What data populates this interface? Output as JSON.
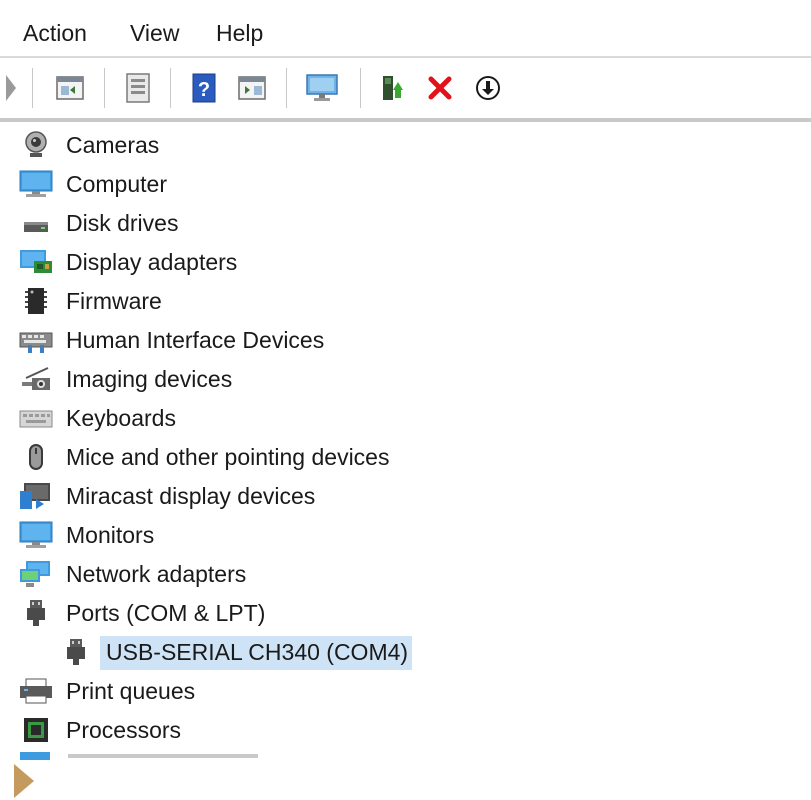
{
  "menu": {
    "action": "Action",
    "view": "View",
    "help": "Help"
  },
  "toolbar": {
    "buttons": [
      "expand-icon",
      "properties-icon",
      "document-icon",
      "help-icon",
      "show-hide-icon",
      "monitor-icon",
      "update-driver-icon",
      "uninstall-icon",
      "download-icon"
    ]
  },
  "tree": {
    "items": [
      {
        "label": "Cameras",
        "icon": "camera-icon"
      },
      {
        "label": "Computer",
        "icon": "computer-icon"
      },
      {
        "label": "Disk drives",
        "icon": "disk-drive-icon"
      },
      {
        "label": "Display adapters",
        "icon": "display-adapter-icon"
      },
      {
        "label": "Firmware",
        "icon": "firmware-icon"
      },
      {
        "label": "Human Interface Devices",
        "icon": "hid-icon"
      },
      {
        "label": "Imaging devices",
        "icon": "imaging-icon"
      },
      {
        "label": "Keyboards",
        "icon": "keyboard-icon"
      },
      {
        "label": "Mice and other pointing devices",
        "icon": "mouse-icon"
      },
      {
        "label": "Miracast display devices",
        "icon": "miracast-icon"
      },
      {
        "label": "Monitors",
        "icon": "monitor-icon"
      },
      {
        "label": "Network adapters",
        "icon": "network-icon"
      },
      {
        "label": "Ports (COM & LPT)",
        "icon": "port-icon"
      },
      {
        "label": "USB-SERIAL CH340 (COM4)",
        "icon": "port-icon",
        "selected": true
      },
      {
        "label": "Print queues",
        "icon": "printer-icon"
      },
      {
        "label": "Processors",
        "icon": "processor-icon"
      }
    ]
  },
  "colors": {
    "selection": "#cfe3f6",
    "uninstall_red": "#e0121b",
    "update_green": "#3aa832",
    "arrow_brown": "#c49a5e"
  }
}
